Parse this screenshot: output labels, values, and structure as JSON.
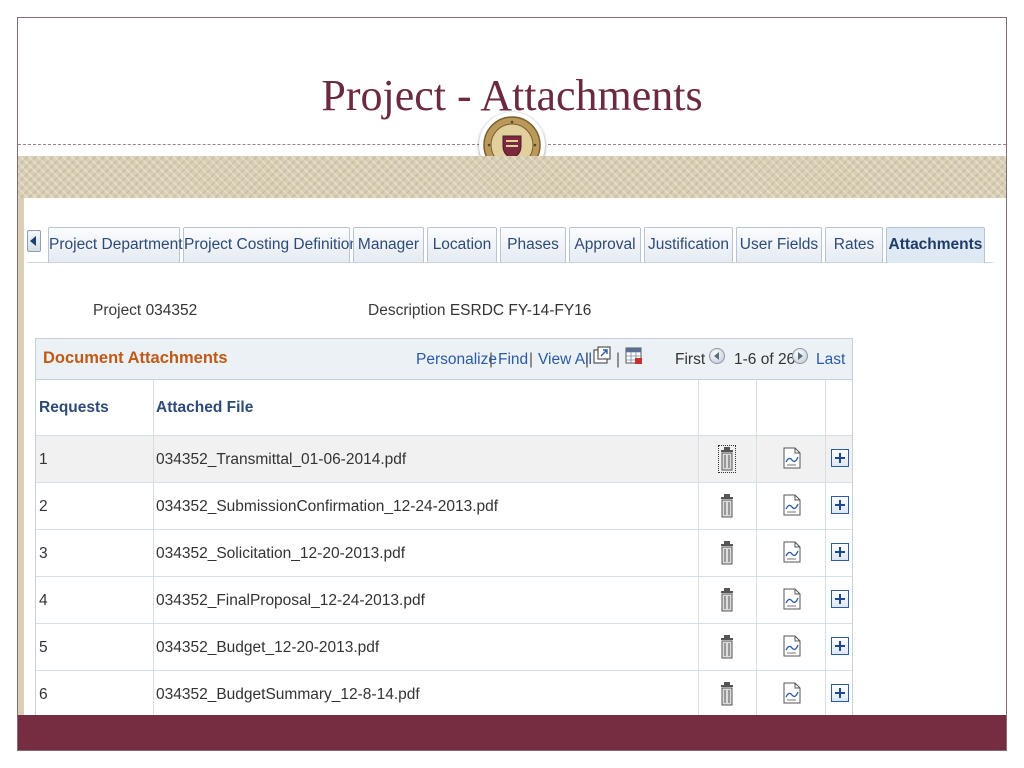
{
  "slide": {
    "title": "Project - Attachments",
    "colors": {
      "title": "#6b2a40",
      "footer": "#762c41",
      "band": "#d8cfb4"
    },
    "seal_icon": "university-seal-icon"
  },
  "tabs": [
    {
      "label": "Project Department",
      "active": false
    },
    {
      "label": "Project Costing Definition",
      "active": false
    },
    {
      "label": "Manager",
      "active": false
    },
    {
      "label": "Location",
      "active": false
    },
    {
      "label": "Phases",
      "active": false
    },
    {
      "label": "Approval",
      "active": false
    },
    {
      "label": "Justification",
      "active": false
    },
    {
      "label": "User Fields",
      "active": false
    },
    {
      "label": "Rates",
      "active": false
    },
    {
      "label": "Attachments",
      "active": true
    }
  ],
  "project": {
    "project_label": "Project",
    "project_value": "034352",
    "description_label": "Description",
    "description_value": "ESRDC FY-14-FY16"
  },
  "grid": {
    "title": "Document Attachments",
    "personalize": "Personalize",
    "find": "Find",
    "view_all": "View All",
    "separator": "|",
    "first": "First",
    "range": "1-6 of 26",
    "last": "Last",
    "columns": {
      "requests": "Requests",
      "attached_file": "Attached File"
    },
    "rows": [
      {
        "request": "1",
        "file": "034352_Transmittal_01-06-2014.pdf"
      },
      {
        "request": "2",
        "file": "034352_SubmissionConfirmation_12-24-2013.pdf"
      },
      {
        "request": "3",
        "file": "034352_Solicitation_12-20-2013.pdf"
      },
      {
        "request": "4",
        "file": "034352_FinalProposal_12-24-2013.pdf"
      },
      {
        "request": "5",
        "file": "034352_Budget_12-20-2013.pdf"
      },
      {
        "request": "6",
        "file": "034352_BudgetSummary_12-8-14.pdf"
      }
    ]
  }
}
